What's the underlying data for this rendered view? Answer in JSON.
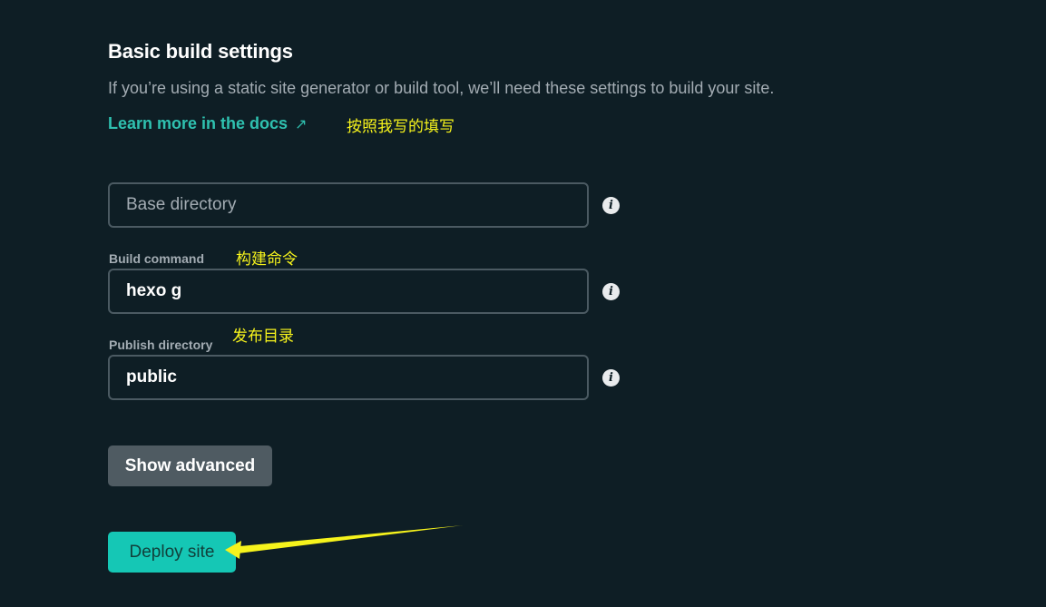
{
  "section": {
    "title": "Basic build settings",
    "description": "If you’re using a static site generator or build tool, we’ll need these settings to build your site.",
    "docs_link": "Learn more in the docs",
    "docs_link_arrow": "↗"
  },
  "fields": {
    "base_directory": {
      "placeholder": "Base directory",
      "value": ""
    },
    "build_command": {
      "label": "Build command",
      "value": "hexo g"
    },
    "publish_directory": {
      "label": "Publish directory",
      "value": "public"
    },
    "info_glyph": "i"
  },
  "buttons": {
    "show_advanced": "Show advanced",
    "deploy": "Deploy site"
  },
  "annotations": {
    "fill_as_written": "按照我写的填写",
    "build_command": "构建命令",
    "publish_directory": "发布目录",
    "color": "#f6f31c"
  },
  "colors": {
    "background": "#0e1e25",
    "accent": "#15c7b5",
    "link": "#2fc1b0",
    "muted_text": "#a3acb3",
    "input_border": "#4b5a62",
    "secondary_button": "#4f5b62"
  },
  "icons": {
    "info": "info-icon",
    "external_link": "external-link-arrow-icon",
    "annotation_arrow": "annotation-arrow"
  }
}
